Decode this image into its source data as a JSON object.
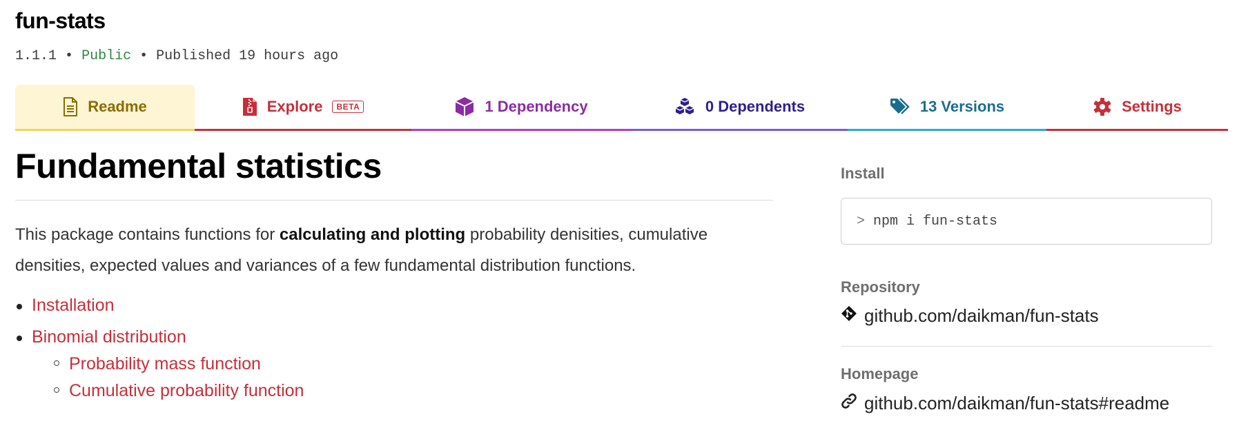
{
  "package": {
    "name": "fun-stats",
    "version": "1.1.1",
    "separator": "•",
    "visibility": "Public",
    "published": "Published 19 hours ago"
  },
  "tabs": [
    {
      "label": "Readme",
      "icon": "file-icon",
      "color": "#8a6d00"
    },
    {
      "label": "Explore",
      "badge": "BETA",
      "icon": "zip-file-icon",
      "color": "#c62f3a"
    },
    {
      "label": "1 Dependency",
      "icon": "box-icon",
      "color": "#8b2ca3"
    },
    {
      "label": "0 Dependents",
      "icon": "boxes-icon",
      "color": "#2d1f8f"
    },
    {
      "label": "13 Versions",
      "icon": "tags-icon",
      "color": "#1a6d8e"
    },
    {
      "label": "Settings",
      "icon": "gear-icon",
      "color": "#c62f3a"
    }
  ],
  "readme": {
    "title": "Fundamental statistics",
    "intro_before": "This package contains functions for ",
    "intro_bold": "calculating and plotting",
    "intro_after": " probability denisities, cumulative densities, expected values and variances of a few fundamental distribution functions.",
    "toc": [
      {
        "label": "Installation"
      },
      {
        "label": "Binomial distribution",
        "children": [
          {
            "label": "Probability mass function"
          },
          {
            "label": "Cumulative probability function"
          }
        ]
      }
    ]
  },
  "sidebar": {
    "install_label": "Install",
    "install_prompt": ">",
    "install_command": "npm i fun-stats",
    "repository_label": "Repository",
    "repository_link": "github.com/daikman/fun-stats",
    "homepage_label": "Homepage",
    "homepage_link": "github.com/daikman/fun-stats#readme"
  },
  "colors": {
    "accent_red": "#c62f3a",
    "public_green": "#2e8540",
    "readme_tab_bg": "#fdf5d3"
  }
}
